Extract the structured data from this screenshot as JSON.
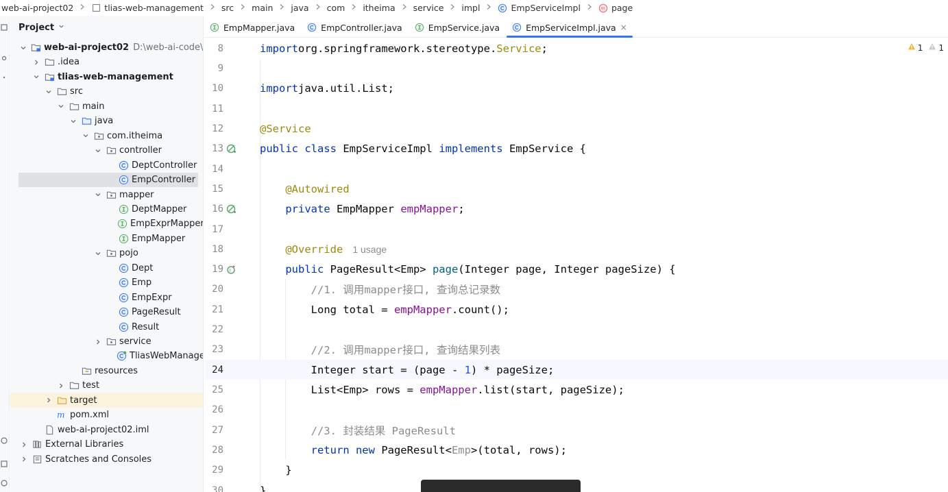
{
  "breadcrumb": [
    {
      "label": "web-ai-project02",
      "icon": "none"
    },
    {
      "label": "tlias-web-management",
      "icon": "module-icon"
    },
    {
      "label": "src",
      "icon": "none"
    },
    {
      "label": "main",
      "icon": "none"
    },
    {
      "label": "java",
      "icon": "none"
    },
    {
      "label": "com",
      "icon": "none"
    },
    {
      "label": "itheima",
      "icon": "none"
    },
    {
      "label": "service",
      "icon": "none"
    },
    {
      "label": "impl",
      "icon": "none"
    },
    {
      "label": "EmpServiceImpl",
      "icon": "class-icon"
    },
    {
      "label": "page",
      "icon": "method-icon"
    }
  ],
  "project_panel": {
    "title": "Project",
    "tree": [
      {
        "label": "web-ai-project02",
        "hint": "D:\\web-ai-code\\we",
        "depth": 0,
        "arrow": "down",
        "icon": "module",
        "bold": true
      },
      {
        "label": ".idea",
        "depth": 1,
        "arrow": "right",
        "icon": "folder"
      },
      {
        "label": "tlias-web-management",
        "depth": 1,
        "arrow": "down",
        "icon": "module",
        "bold": true
      },
      {
        "label": "src",
        "depth": 2,
        "arrow": "down",
        "icon": "folder"
      },
      {
        "label": "main",
        "depth": 3,
        "arrow": "down",
        "icon": "folder"
      },
      {
        "label": "java",
        "depth": 4,
        "arrow": "down",
        "icon": "source-folder"
      },
      {
        "label": "com.itheima",
        "depth": 5,
        "arrow": "down",
        "icon": "package"
      },
      {
        "label": "controller",
        "depth": 6,
        "arrow": "down",
        "icon": "package"
      },
      {
        "label": "DeptController",
        "depth": 7,
        "arrow": "none",
        "icon": "class"
      },
      {
        "label": "EmpController",
        "depth": 7,
        "arrow": "none",
        "icon": "class",
        "selected": true
      },
      {
        "label": "mapper",
        "depth": 6,
        "arrow": "down",
        "icon": "package"
      },
      {
        "label": "DeptMapper",
        "depth": 7,
        "arrow": "none",
        "icon": "interface"
      },
      {
        "label": "EmpExprMapper",
        "depth": 7,
        "arrow": "none",
        "icon": "interface"
      },
      {
        "label": "EmpMapper",
        "depth": 7,
        "arrow": "none",
        "icon": "interface"
      },
      {
        "label": "pojo",
        "depth": 6,
        "arrow": "down",
        "icon": "package"
      },
      {
        "label": "Dept",
        "depth": 7,
        "arrow": "none",
        "icon": "class"
      },
      {
        "label": "Emp",
        "depth": 7,
        "arrow": "none",
        "icon": "class"
      },
      {
        "label": "EmpExpr",
        "depth": 7,
        "arrow": "none",
        "icon": "class"
      },
      {
        "label": "PageResult",
        "depth": 7,
        "arrow": "none",
        "icon": "class"
      },
      {
        "label": "Result",
        "depth": 7,
        "arrow": "none",
        "icon": "class"
      },
      {
        "label": "service",
        "depth": 6,
        "arrow": "right",
        "icon": "package"
      },
      {
        "label": "TliasWebManageme",
        "depth": 7,
        "arrow": "none",
        "icon": "spring-class",
        "offset": -1
      },
      {
        "label": "resources",
        "depth": 4,
        "arrow": "none",
        "icon": "resources-folder"
      },
      {
        "label": "test",
        "depth": 3,
        "arrow": "right",
        "icon": "folder"
      },
      {
        "label": "target",
        "depth": 2,
        "arrow": "right",
        "icon": "target-folder",
        "highlight": true
      },
      {
        "label": "pom.xml",
        "depth": 2,
        "arrow": "none",
        "icon": "maven"
      },
      {
        "label": "web-ai-project02.iml",
        "depth": 1,
        "arrow": "none",
        "icon": "file"
      },
      {
        "label": "External Libraries",
        "depth": 0,
        "arrow": "right",
        "icon": "libraries"
      },
      {
        "label": "Scratches and Consoles",
        "depth": 0,
        "arrow": "right",
        "icon": "scratches"
      }
    ]
  },
  "tabs": [
    {
      "label": "EmpMapper.java",
      "icon": "interface",
      "active": false
    },
    {
      "label": "EmpController.java",
      "icon": "class",
      "active": false
    },
    {
      "label": "EmpService.java",
      "icon": "interface",
      "active": false
    },
    {
      "label": "EmpServiceImpl.java",
      "icon": "class",
      "active": true,
      "close": "×"
    }
  ],
  "warnings": [
    {
      "count": "1"
    },
    {
      "count": "1"
    }
  ],
  "editor": {
    "current_line": 24,
    "usage_hint": "1 usage",
    "lines": [
      {
        "no": "8",
        "tokens": [
          [
            "kw",
            "import"
          ],
          [
            "",
            "org.springframework.stereotype."
          ],
          [
            "ann",
            "Service"
          ],
          [
            "",
            ";"
          ]
        ]
      },
      {
        "no": "9",
        "tokens": []
      },
      {
        "no": "10",
        "tokens": [
          [
            "kw",
            "import"
          ],
          [
            "",
            "java.util.List;"
          ]
        ]
      },
      {
        "no": "11",
        "tokens": []
      },
      {
        "no": "12",
        "tokens": [
          [
            "ann",
            "@Service"
          ]
        ]
      },
      {
        "no": "13",
        "gutter": "bean",
        "tokens": [
          [
            "kw",
            "public class "
          ],
          [
            "",
            "EmpServiceImpl "
          ],
          [
            "kw",
            "implements "
          ],
          [
            "",
            "EmpService {"
          ]
        ]
      },
      {
        "no": "14",
        "tokens": []
      },
      {
        "no": "15",
        "tokens": [
          [
            "",
            "    "
          ],
          [
            "ann",
            "@Autowired"
          ]
        ]
      },
      {
        "no": "16",
        "gutter": "bean",
        "tokens": [
          [
            "",
            "    "
          ],
          [
            "kw",
            "private "
          ],
          [
            "",
            "EmpMapper "
          ],
          [
            "fld",
            "empMapper"
          ],
          [
            "",
            ";"
          ]
        ]
      },
      {
        "no": "17",
        "tokens": []
      },
      {
        "no": "18",
        "hint": true,
        "tokens": [
          [
            "",
            "    "
          ],
          [
            "ann",
            "@Override"
          ]
        ]
      },
      {
        "no": "19",
        "gutter": "override",
        "tokens": [
          [
            "",
            "    "
          ],
          [
            "kw",
            "public "
          ],
          [
            "",
            "PageResult<Emp> "
          ],
          [
            "fn",
            "page"
          ],
          [
            "",
            "(Integer page, Integer pageSize) {"
          ]
        ]
      },
      {
        "no": "20",
        "tokens": [
          [
            "",
            "        "
          ],
          [
            "cmt",
            "//1. 调用mapper接口, 查询总记录数"
          ]
        ]
      },
      {
        "no": "21",
        "tokens": [
          [
            "",
            "        Long total = "
          ],
          [
            "fld",
            "empMapper"
          ],
          [
            "",
            ".count();"
          ]
        ]
      },
      {
        "no": "22",
        "tokens": []
      },
      {
        "no": "23",
        "tokens": [
          [
            "",
            "        "
          ],
          [
            "cmt",
            "//2. 调用mapper接口, 查询结果列表"
          ]
        ]
      },
      {
        "no": "24",
        "tokens": [
          [
            "",
            "        Integer start = (page - "
          ],
          [
            "num",
            "1"
          ],
          [
            "",
            ") * pageSize;"
          ]
        ]
      },
      {
        "no": "25",
        "tokens": [
          [
            "",
            "        List<Emp> rows = "
          ],
          [
            "fld",
            "empMapper"
          ],
          [
            "",
            ".list(start, pageSize);"
          ]
        ]
      },
      {
        "no": "26",
        "tokens": []
      },
      {
        "no": "27",
        "tokens": [
          [
            "",
            "        "
          ],
          [
            "cmt",
            "//3. 封装结果 PageResult"
          ]
        ]
      },
      {
        "no": "28",
        "tokens": [
          [
            "",
            "        "
          ],
          [
            "kw",
            "return new "
          ],
          [
            "",
            "PageResult<"
          ],
          [
            "typ-gray",
            "Emp"
          ],
          [
            "",
            ">(total, rows);"
          ]
        ]
      },
      {
        "no": "29",
        "tokens": [
          [
            "",
            "    }"
          ]
        ]
      },
      {
        "no": "30",
        "tokens": [
          [
            "",
            "}"
          ]
        ]
      }
    ]
  },
  "colors": {
    "accent": "#3574f0",
    "keyword": "#0033b3",
    "annotation": "#9e880d",
    "field": "#871094",
    "method": "#00627a",
    "comment": "#8c8c8c",
    "number": "#1750eb"
  }
}
